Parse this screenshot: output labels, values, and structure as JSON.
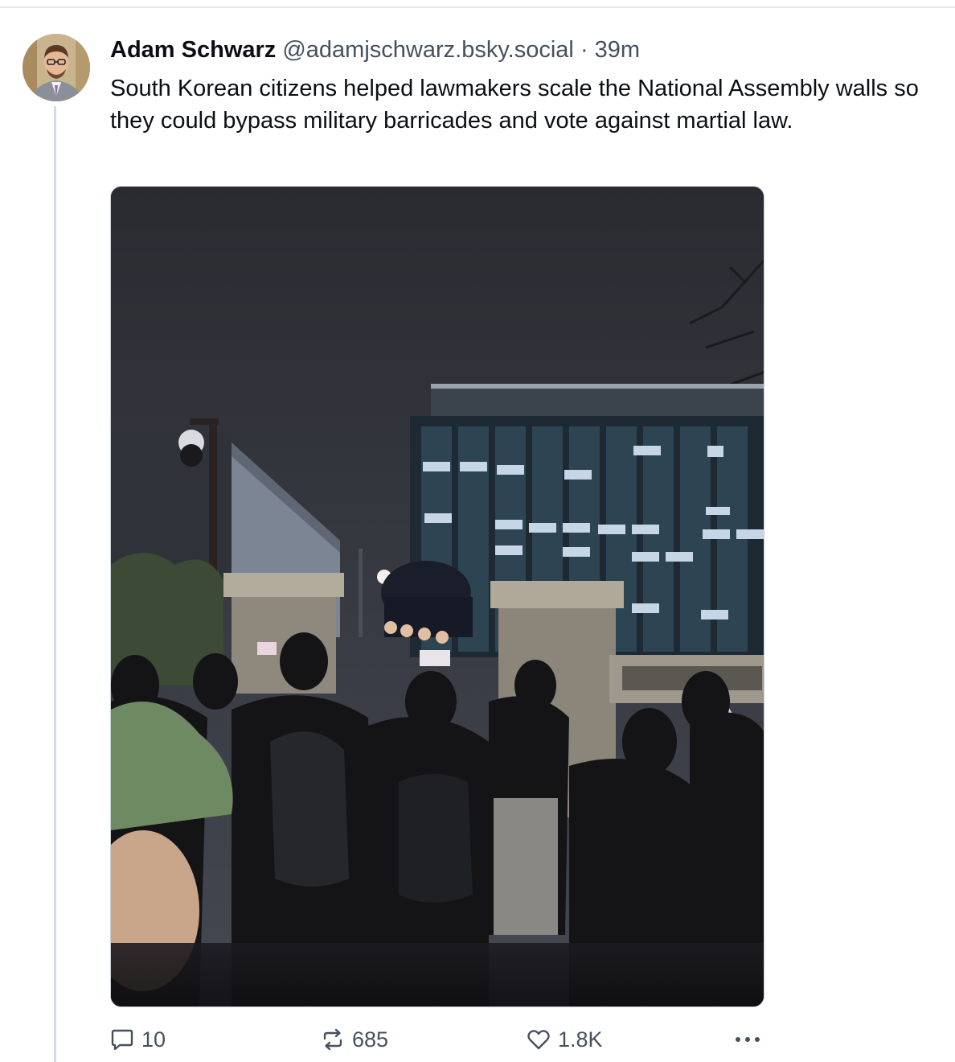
{
  "post": {
    "author": {
      "display_name": "Adam Schwarz",
      "handle": "@adamjschwarz.bsky.social",
      "separator": "·",
      "time": "39m",
      "avatar": "profile-photo"
    },
    "text": "South Korean citizens helped lawmakers scale the National Assembly walls so they could bypass military barricades and vote against martial law.",
    "image": {
      "subject": "crowd-at-night-helping-person-climb-wall"
    },
    "actions": {
      "reply_count": "10",
      "repost_count": "685",
      "like_count": "1.8K",
      "reply_icon": "speech-bubble-icon",
      "repost_icon": "repost-arrows-icon",
      "like_icon": "heart-icon",
      "more_icon": "ellipsis-icon"
    }
  },
  "colors": {
    "text_primary": "#0b0f14",
    "text_secondary": "#45515e",
    "thread_line": "#d4dbe2",
    "divider": "#e2e6ea"
  }
}
